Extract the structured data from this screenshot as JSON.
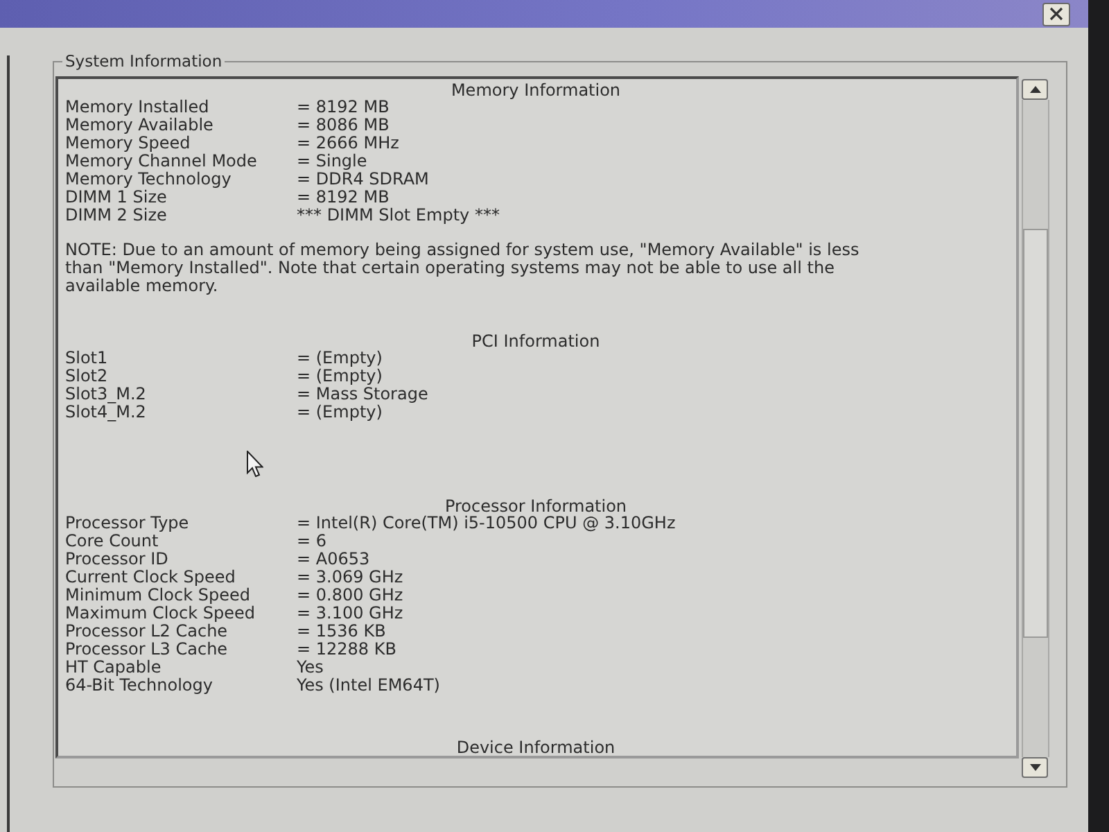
{
  "system_information": {
    "legend": "System Information",
    "sections": [
      {
        "title": "Memory Information",
        "rows": [
          {
            "label": "Memory Installed",
            "value": "= 8192 MB"
          },
          {
            "label": "Memory Available",
            "value": "= 8086 MB"
          },
          {
            "label": "Memory Speed",
            "value": "= 2666 MHz"
          },
          {
            "label": "Memory Channel Mode",
            "value": "= Single"
          },
          {
            "label": "Memory Technology",
            "value": "= DDR4 SDRAM"
          },
          {
            "label": "DIMM 1 Size",
            "value": "= 8192 MB"
          },
          {
            "label": "DIMM 2 Size",
            "value": "*** DIMM Slot Empty ***"
          }
        ],
        "note": "NOTE: Due to an amount of memory being assigned for system use, \"Memory Available\" is less than \"Memory Installed\". Note that certain operating systems may not be able to use all the available memory."
      },
      {
        "title": "PCI Information",
        "rows": [
          {
            "label": "Slot1",
            "value": "= (Empty)"
          },
          {
            "label": "Slot2",
            "value": "= (Empty)"
          },
          {
            "label": "Slot3_M.2",
            "value": "= Mass Storage"
          },
          {
            "label": "Slot4_M.2",
            "value": "= (Empty)"
          }
        ]
      },
      {
        "title": "Processor Information",
        "rows": [
          {
            "label": "Processor Type",
            "value": "= Intel(R) Core(TM) i5-10500 CPU @ 3.10GHz"
          },
          {
            "label": "Core Count",
            "value": "= 6"
          },
          {
            "label": "Processor ID",
            "value": "= A0653"
          },
          {
            "label": "Current Clock Speed",
            "value": "= 3.069 GHz"
          },
          {
            "label": "Minimum Clock Speed",
            "value": "= 0.800 GHz"
          },
          {
            "label": "Maximum Clock Speed",
            "value": "= 3.100 GHz"
          },
          {
            "label": "Processor L2 Cache",
            "value": "= 1536 KB"
          },
          {
            "label": "Processor L3 Cache",
            "value": "= 12288 KB"
          },
          {
            "label": "HT Capable",
            "value": "Yes"
          },
          {
            "label": "64-Bit Technology",
            "value": "Yes (Intel EM64T)"
          }
        ]
      },
      {
        "title": "Device Information"
      }
    ]
  }
}
